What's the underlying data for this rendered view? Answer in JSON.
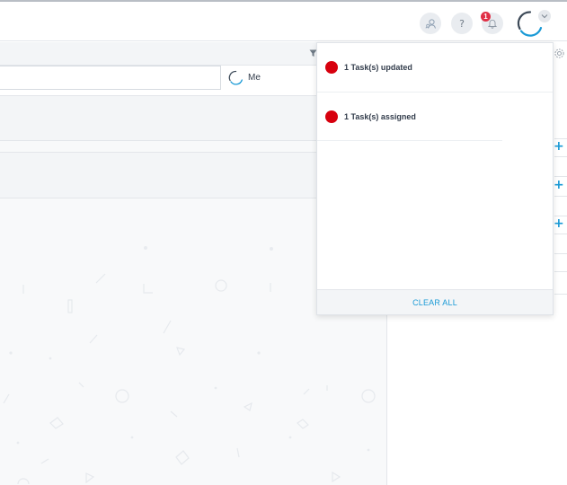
{
  "header": {
    "profile_search_icon": "user-search-icon",
    "help_label": "?",
    "notifications_icon": "bell-icon",
    "notification_count": "1",
    "avatar_icon": "avatar-ring",
    "avatar_menu_icon": "chevron-down-icon"
  },
  "toolbar": {
    "filter_icon": "filter-icon",
    "search_value": "",
    "me_label": "Me"
  },
  "sidebar": {
    "settings_icon": "gear-icon",
    "add_icon": "+"
  },
  "notifications": {
    "items": [
      {
        "label": "1 Task(s) updated",
        "status_color": "#d7000e"
      },
      {
        "label": "1 Task(s) assigned",
        "status_color": "#d7000e"
      }
    ],
    "clear_all_label": "CLEAR ALL"
  },
  "colors": {
    "accent": "#1a9ad6",
    "badge": "#e02f45",
    "status_dot": "#d7000e"
  }
}
